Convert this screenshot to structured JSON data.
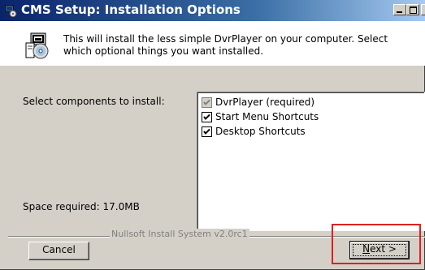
{
  "window": {
    "title": "CMS Setup: Installation Options"
  },
  "header": {
    "description": "This will install the less simple DvrPlayer on your computer. Select which optional things you want installed."
  },
  "labels": {
    "select_components": "Select components to install:",
    "space_required": "Space required: 17.0MB"
  },
  "components": [
    {
      "label": "DvrPlayer (required)",
      "checked": true,
      "disabled": true
    },
    {
      "label": "Start Menu Shortcuts",
      "checked": true,
      "disabled": false
    },
    {
      "label": "Desktop Shortcuts",
      "checked": true,
      "disabled": false
    }
  ],
  "footer": {
    "cancel_label": "Cancel",
    "branding": "Nullsoft Install System v2.0rc1",
    "next_prefix": "N",
    "next_rest": "ext >"
  },
  "colors": {
    "title_start": "#0a246a",
    "title_end": "#a6caf0",
    "face": "#d4d0c8",
    "highlight": "#e02020"
  }
}
